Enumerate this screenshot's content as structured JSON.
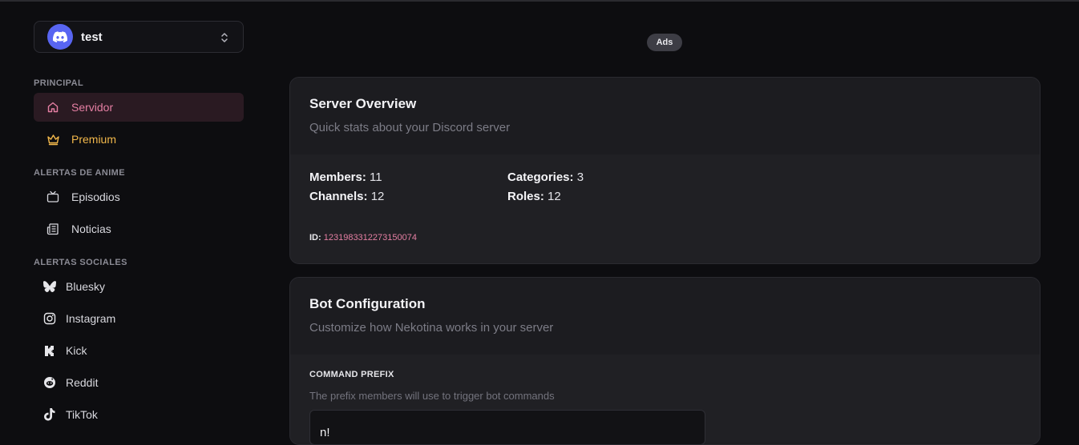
{
  "server": {
    "name": "test"
  },
  "sidebar": {
    "sections": [
      {
        "label": "PRINCIPAL"
      },
      {
        "label": "ALERTAS DE ANIME"
      },
      {
        "label": "ALERTAS SOCIALES"
      }
    ],
    "items": [
      {
        "label": "Servidor",
        "icon": "home-icon",
        "active": true
      },
      {
        "label": "Premium",
        "icon": "crown-icon"
      },
      {
        "label": "Episodios",
        "icon": "tv-icon"
      },
      {
        "label": "Noticias",
        "icon": "newspaper-icon"
      },
      {
        "label": "Bluesky",
        "icon": "butterfly-icon"
      },
      {
        "label": "Instagram",
        "icon": "instagram-icon"
      },
      {
        "label": "Kick",
        "icon": "kick-icon"
      },
      {
        "label": "Reddit",
        "icon": "reddit-icon"
      },
      {
        "label": "TikTok",
        "icon": "tiktok-icon"
      }
    ]
  },
  "ads": {
    "label": "Ads"
  },
  "overview": {
    "title": "Server Overview",
    "subtitle": "Quick stats about your Discord server",
    "members_label": "Members:",
    "members": "11",
    "channels_label": "Channels:",
    "channels": "12",
    "categories_label": "Categories:",
    "categories": "3",
    "roles_label": "Roles:",
    "roles": "12",
    "id_label": "ID:",
    "id": "1231983312273150074"
  },
  "bot_config": {
    "title": "Bot Configuration",
    "subtitle": "Customize how Nekotina works in your server",
    "prefix_label": "COMMAND PREFIX",
    "prefix_help": "The prefix members will use to trigger bot commands",
    "prefix_value": "n!"
  },
  "colors": {
    "accent": "#e57fa3",
    "premium": "#f2b84b",
    "discord": "#5865f2",
    "background": "#0d0d10",
    "card": "#1e1e22"
  }
}
